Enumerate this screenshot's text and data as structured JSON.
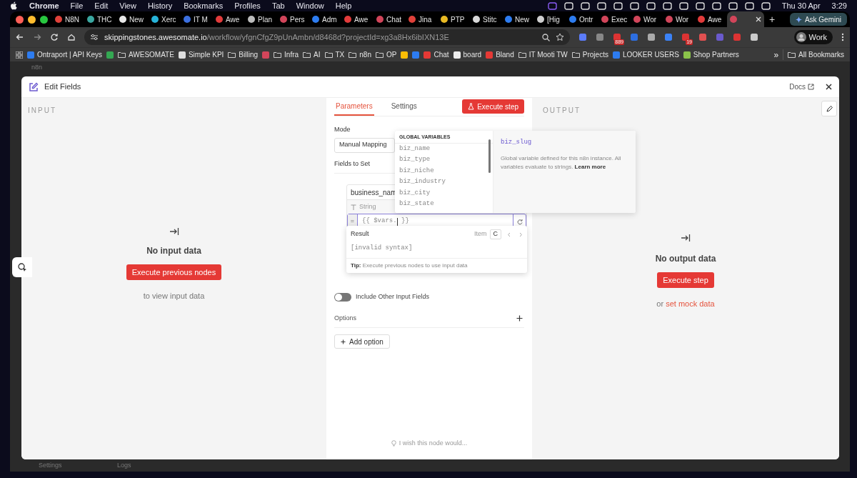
{
  "menu_bar": {
    "app": "Chrome",
    "items": [
      "File",
      "Edit",
      "View",
      "History",
      "Bookmarks",
      "Profiles",
      "Tab",
      "Window",
      "Help"
    ],
    "date": "Thu 30 Apr",
    "time": "3:29"
  },
  "tabs": [
    {
      "title": "N8N",
      "color": "#e0413a",
      "selected": false
    },
    {
      "title": "THC",
      "color": "#3aa7a0",
      "selected": false
    },
    {
      "title": "New",
      "color": "#e8e8e8",
      "selected": false
    },
    {
      "title": "Xerc",
      "color": "#27b3d9",
      "selected": false
    },
    {
      "title": "IT M",
      "color": "#3b6fe0",
      "selected": false
    },
    {
      "title": "Awe",
      "color": "#e23b3b",
      "selected": false
    },
    {
      "title": "Plan",
      "color": "#bdbdbd",
      "selected": false
    },
    {
      "title": "Pers",
      "color": "#d2455a",
      "selected": false
    },
    {
      "title": "Adm",
      "color": "#2d7cf0",
      "selected": false
    },
    {
      "title": "Awe",
      "color": "#e23b3b",
      "selected": false
    },
    {
      "title": "Chat",
      "color": "#d2455a",
      "selected": false
    },
    {
      "title": "Jina",
      "color": "#e0413a",
      "selected": false
    },
    {
      "title": "PTP",
      "color": "#e8b923",
      "selected": false
    },
    {
      "title": "Stitc",
      "color": "#d9d9d9",
      "selected": false
    },
    {
      "title": "New",
      "color": "#2d7cf0",
      "selected": false
    },
    {
      "title": "[Hig",
      "color": "#cfcfcf",
      "selected": false
    },
    {
      "title": "Ontr",
      "color": "#2d7cf0",
      "selected": false
    },
    {
      "title": "Exec",
      "color": "#d2455a",
      "selected": false
    },
    {
      "title": "Wor",
      "color": "#d2455a",
      "selected": false
    },
    {
      "title": "Wor",
      "color": "#d2455a",
      "selected": false
    },
    {
      "title": "Awe",
      "color": "#e23b3b",
      "selected": false
    },
    {
      "color": "#d2455a",
      "selected": true
    }
  ],
  "new_tab": "+",
  "gemini": "Ask Gemini",
  "address": {
    "host": "skippingstones.awesomate.io",
    "path": "/workflow/yfgnCfgZ9pUnAmbn/d8468d?projectId=xg3a8Hx6ibIXN13E"
  },
  "extension_badges": [
    "889",
    "19"
  ],
  "profile": "Work",
  "bookmarks": [
    {
      "kind": "site",
      "label": "Ontraport | API Keys"
    },
    {
      "kind": "site"
    },
    {
      "kind": "folder",
      "label": "AWESOMATE"
    },
    {
      "kind": "site",
      "label": "Simple KPI"
    },
    {
      "kind": "folder",
      "label": "Billing"
    },
    {
      "kind": "site"
    },
    {
      "kind": "folder",
      "label": "Infra"
    },
    {
      "kind": "folder",
      "label": "AI"
    },
    {
      "kind": "folder",
      "label": "TX"
    },
    {
      "kind": "folder",
      "label": "n8n"
    },
    {
      "kind": "folder",
      "label": "OP"
    },
    {
      "kind": "site"
    },
    {
      "kind": "site"
    },
    {
      "kind": "site",
      "label": "Chat"
    },
    {
      "kind": "site",
      "label": "board"
    },
    {
      "kind": "site",
      "label": "Bland"
    },
    {
      "kind": "folder",
      "label": "IT Mooti TW"
    },
    {
      "kind": "folder",
      "label": "Projects"
    },
    {
      "kind": "site",
      "label": "LOOKER USERS"
    },
    {
      "kind": "site",
      "label": "Shop Partners"
    }
  ],
  "bookmarks_more": "»",
  "all_bookmarks": "All Bookmarks",
  "app": {
    "logo": "n8n",
    "settings": "Settings",
    "logs": "Logs"
  },
  "modal": {
    "title": "Edit Fields",
    "docs": "Docs",
    "input": {
      "label": "INPUT",
      "empty": "No input data",
      "button": "Execute previous nodes",
      "hint": "to view input data"
    },
    "tabs": [
      {
        "label": "Parameters",
        "selected": true
      },
      {
        "label": "Settings",
        "selected": false
      }
    ],
    "execute": "Execute step",
    "mode": {
      "label": "Mode",
      "value": "Manual Mapping"
    },
    "fields_label": "Fields to Set",
    "field": {
      "name": "business_nam",
      "type": "String",
      "prefix": "=",
      "expression_before": "{{ $vars.",
      "expression_after": " }}"
    },
    "result": {
      "label": "Result",
      "item_label": "Item",
      "item": "C",
      "value": "[invalid syntax]",
      "tip": "**Tip:** Execute previous nodes to use input data"
    },
    "include_other": {
      "label": "Include Other Input Fields",
      "on": false
    },
    "options": {
      "label": "Options",
      "add": "Add option"
    },
    "feedback": "I wish this node would...",
    "variables": {
      "heading": "GLOBAL VARIABLES",
      "items": [
        "biz_name",
        "biz_type",
        "biz_niche",
        "biz_industry",
        "biz_city",
        "biz_state"
      ]
    },
    "variable_info": {
      "name": "biz_slug",
      "text": "Global variable defined for this n8n instance. All variables evaluate to strings.",
      "link": "Learn more"
    },
    "output": {
      "label": "OUTPUT",
      "empty": "No output data",
      "button": "Execute step",
      "hint_prefix": "or",
      "hint_link": "set mock data"
    }
  }
}
